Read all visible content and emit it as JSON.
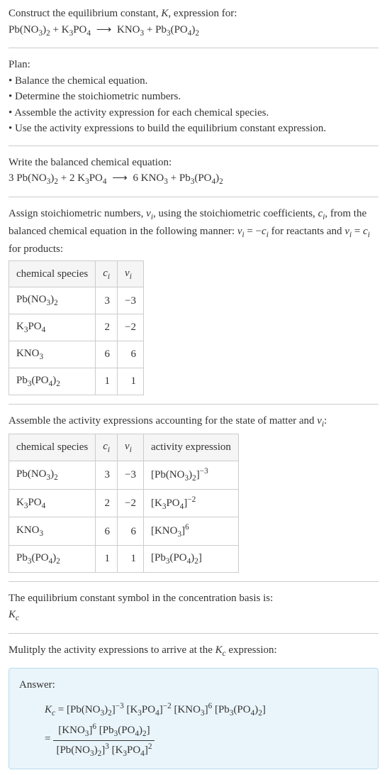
{
  "intro": {
    "line1": "Construct the equilibrium constant, ",
    "k": "K",
    "line1b": ", expression for:"
  },
  "equation_unbalanced": {
    "r1": "Pb(NO",
    "r1s1": "3",
    "r1b": ")",
    "r1s2": "2",
    "plus1": " + K",
    "r2s1": "3",
    "r2b": "PO",
    "r2s2": "4",
    "arrow": " ⟶ ",
    "p1": "KNO",
    "p1s1": "3",
    "plus2": " + Pb",
    "p2s1": "3",
    "p2b": "(PO",
    "p2s2": "4",
    "p2c": ")",
    "p2s3": "2"
  },
  "plan": {
    "heading": "Plan:",
    "items": [
      "Balance the chemical equation.",
      "Determine the stoichiometric numbers.",
      "Assemble the activity expression for each chemical species.",
      "Use the activity expressions to build the equilibrium constant expression."
    ]
  },
  "balanced_heading": "Write the balanced chemical equation:",
  "equation_balanced": {
    "c1": "3 Pb(NO",
    "r1s1": "3",
    "r1b": ")",
    "r1s2": "2",
    "plus1": " + 2 K",
    "r2s1": "3",
    "r2b": "PO",
    "r2s2": "4",
    "arrow": " ⟶ ",
    "c3": "6 KNO",
    "p1s1": "3",
    "plus2": " + Pb",
    "p2s1": "3",
    "p2b": "(PO",
    "p2s2": "4",
    "p2c": ")",
    "p2s3": "2"
  },
  "assign_text": {
    "a": "Assign stoichiometric numbers, ",
    "vi": "ν",
    "visub": "i",
    "b": ", using the stoichiometric coefficients, ",
    "ci": "c",
    "cisub": "i",
    "c": ", from the balanced chemical equation in the following manner: ",
    "eq1a": "ν",
    "eq1b": "i",
    "eq1c": " = −",
    "eq1d": "c",
    "eq1e": "i",
    "d": " for reactants and ",
    "eq2a": "ν",
    "eq2b": "i",
    "eq2c": " = ",
    "eq2d": "c",
    "eq2e": "i",
    "e": " for products:"
  },
  "table1": {
    "headers": {
      "h1": "chemical species",
      "h2a": "c",
      "h2b": "i",
      "h3a": "ν",
      "h3b": "i"
    },
    "rows": [
      {
        "species_a": "Pb(NO",
        "s1": "3",
        "species_b": ")",
        "s2": "2",
        "ci": "3",
        "vi": "−3"
      },
      {
        "species_a": "K",
        "s1": "3",
        "species_b": "PO",
        "s2": "4",
        "ci": "2",
        "vi": "−2"
      },
      {
        "species_a": "KNO",
        "s1": "3",
        "species_b": "",
        "s2": "",
        "ci": "6",
        "vi": "6"
      },
      {
        "species_a": "Pb",
        "s1": "3",
        "species_b": "(PO",
        "s2": "4",
        "species_c": ")",
        "s3": "2",
        "ci": "1",
        "vi": "1"
      }
    ]
  },
  "assemble_text": {
    "a": "Assemble the activity expressions accounting for the state of matter and ",
    "vi": "ν",
    "visub": "i",
    "b": ":"
  },
  "table2": {
    "headers": {
      "h1": "chemical species",
      "h2a": "c",
      "h2b": "i",
      "h3a": "ν",
      "h3b": "i",
      "h4": "activity expression"
    },
    "rows": [
      {
        "species_a": "Pb(NO",
        "s1": "3",
        "species_b": ")",
        "s2": "2",
        "ci": "3",
        "vi": "−3",
        "act_a": "[Pb(NO",
        "as1": "3",
        "act_b": ")",
        "as2": "2",
        "act_c": "]",
        "exp": "−3"
      },
      {
        "species_a": "K",
        "s1": "3",
        "species_b": "PO",
        "s2": "4",
        "ci": "2",
        "vi": "−2",
        "act_a": "[K",
        "as1": "3",
        "act_b": "PO",
        "as2": "4",
        "act_c": "]",
        "exp": "−2"
      },
      {
        "species_a": "KNO",
        "s1": "3",
        "species_b": "",
        "s2": "",
        "ci": "6",
        "vi": "6",
        "act_a": "[KNO",
        "as1": "3",
        "act_b": "",
        "as2": "",
        "act_c": "]",
        "exp": "6"
      },
      {
        "species_a": "Pb",
        "s1": "3",
        "species_b": "(PO",
        "s2": "4",
        "species_c": ")",
        "s3": "2",
        "ci": "1",
        "vi": "1",
        "act_a": "[Pb",
        "as1": "3",
        "act_b": "(PO",
        "as2": "4",
        "act_bb": ")",
        "as3": "2",
        "act_c": "]",
        "exp": ""
      }
    ]
  },
  "kc_text": {
    "a": "The equilibrium constant symbol in the concentration basis is:",
    "k": "K",
    "ksub": "c"
  },
  "multiply_text": {
    "a": "Mulitply the activity expressions to arrive at the ",
    "k": "K",
    "ksub": "c",
    "b": " expression:"
  },
  "answer": {
    "label": "Answer:",
    "kc": "K",
    "kcsub": "c",
    "eq": " = ",
    "t1a": "[Pb(NO",
    "t1s1": "3",
    "t1b": ")",
    "t1s2": "2",
    "t1c": "]",
    "t1exp": "−3",
    "sp1": " ",
    "t2a": "[K",
    "t2s1": "3",
    "t2b": "PO",
    "t2s2": "4",
    "t2c": "]",
    "t2exp": "−2",
    "sp2": " ",
    "t3a": "[KNO",
    "t3s1": "3",
    "t3c": "]",
    "t3exp": "6",
    "sp3": " ",
    "t4a": "[Pb",
    "t4s1": "3",
    "t4b": "(PO",
    "t4s2": "4",
    "t4c": ")",
    "t4s3": "2",
    "t4d": "]",
    "eq2": "= ",
    "num_a": "[KNO",
    "num_s1": "3",
    "num_b": "]",
    "num_exp1": "6",
    "num_sp": " ",
    "num_c": "[Pb",
    "num_s2": "3",
    "num_d": "(PO",
    "num_s3": "4",
    "num_e": ")",
    "num_s4": "2",
    "num_f": "]",
    "den_a": "[Pb(NO",
    "den_s1": "3",
    "den_b": ")",
    "den_s2": "2",
    "den_c": "]",
    "den_exp1": "3",
    "den_sp": " ",
    "den_d": "[K",
    "den_s3": "3",
    "den_e": "PO",
    "den_s4": "4",
    "den_f": "]",
    "den_exp2": "2"
  }
}
